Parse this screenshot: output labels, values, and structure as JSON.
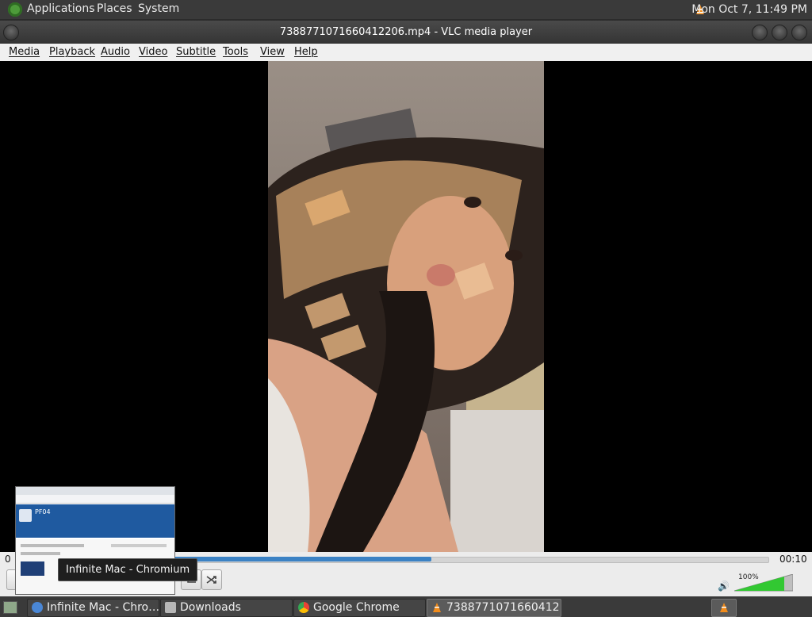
{
  "top_panel": {
    "menus": [
      "Applications",
      "Places",
      "System"
    ],
    "clock": "Mon Oct  7, 11:49 PM"
  },
  "window": {
    "title": "7388771071660412206.mp4 - VLC media player"
  },
  "menubar": {
    "items": [
      "Media",
      "Playback",
      "Audio",
      "Video",
      "Subtitle",
      "Tools",
      "View",
      "Help"
    ]
  },
  "player": {
    "time_elapsed": "0",
    "time_total": "00:10",
    "progress": 0.55,
    "volume_label": "100%",
    "volume_level": 0.85
  },
  "thumbnail": {
    "tooltip": "Infinite Mac - Chromium",
    "page_heading": "PF04"
  },
  "taskbar": {
    "tasks": [
      {
        "label": "Infinite Mac - Chro…",
        "icon": "chromium-icon"
      },
      {
        "label": "Downloads",
        "icon": "folder-icon"
      },
      {
        "label": "Google Chrome",
        "icon": "chrome-icon"
      },
      {
        "label": "7388771071660412…",
        "icon": "vlc-icon"
      }
    ]
  },
  "colors": {
    "accent": "#3b82c4",
    "panel_bg": "#3a3a3a",
    "volume_green": "#32c832"
  }
}
